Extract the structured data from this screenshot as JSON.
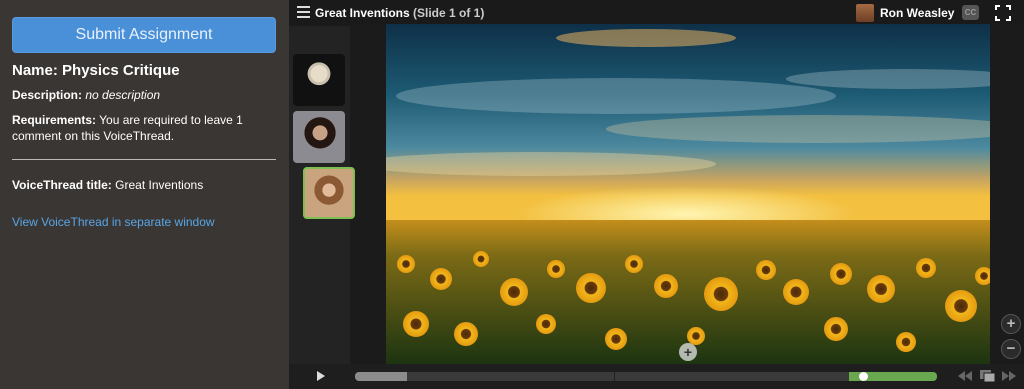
{
  "assignment": {
    "submit_label": "Submit Assignment",
    "name_label": "Name:",
    "name_value": "Physics Critique",
    "description_label": "Description:",
    "description_value": "no description",
    "requirements_label": "Requirements:",
    "requirements_value": "You are required to leave 1 comment on this VoiceThread.",
    "vt_title_label": "VoiceThread title:",
    "vt_title_value": "Great Inventions",
    "view_link": "View VoiceThread in separate window"
  },
  "header": {
    "title": "Great Inventions",
    "slide_indicator": "(Slide 1 of 1)",
    "user_name": "Ron Weasley",
    "cc_label": "CC"
  },
  "slide": {
    "add_comment_label": "+"
  },
  "zoom": {
    "in_label": "+",
    "out_label": "−"
  },
  "colors": {
    "accent": "#4a90d9",
    "link": "#58a6e8",
    "active_avatar_border": "#7ec04f",
    "timeline_green": "#6aa84f"
  },
  "icons": [
    "menu-icon",
    "fullscreen-icon",
    "play-icon",
    "rewind-icon",
    "slides-icon",
    "fast-forward-icon",
    "zoom-in-icon",
    "zoom-out-icon",
    "add-comment-icon"
  ]
}
